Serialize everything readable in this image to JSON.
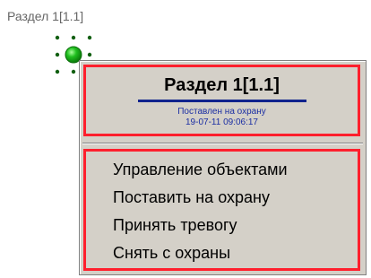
{
  "object": {
    "label": "Раздел 1[1.1]",
    "icon_name": "green-circle-node-icon"
  },
  "context_menu": {
    "title": "Раздел 1[1.1]",
    "status": "Поставлен на охрану",
    "timestamp": "19-07-11 09:06:17",
    "items": [
      {
        "label": "Управление объектами"
      },
      {
        "label": "Поставить на охрану"
      },
      {
        "label": "Принять тревогу"
      },
      {
        "label": "Снять с охраны"
      }
    ]
  },
  "colors": {
    "highlight_border": "#ff1f2d",
    "title_rule": "#10238d",
    "status_text": "#1b2ea3",
    "menu_background": "#d4d0c8",
    "node_fill": "#1fbf1f"
  }
}
